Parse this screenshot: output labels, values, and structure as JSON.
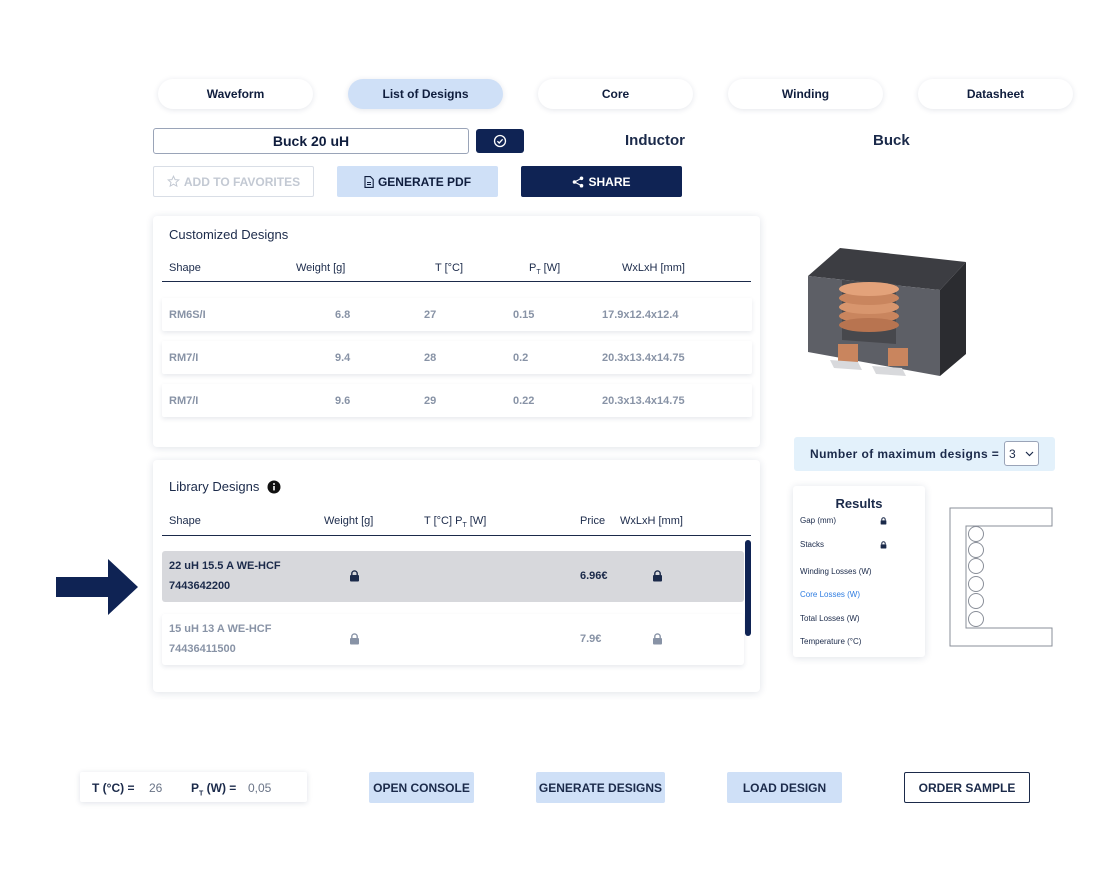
{
  "tabs": [
    {
      "label": "Waveform"
    },
    {
      "label": "List of Designs",
      "active": true
    },
    {
      "label": "Core"
    },
    {
      "label": "Winding"
    },
    {
      "label": "Datasheet"
    }
  ],
  "design": {
    "name": "Buck 20 uH",
    "type": "Inductor",
    "topology": "Buck"
  },
  "actions": {
    "favorites": "ADD TO FAVORITES",
    "pdf": "GENERATE PDF",
    "share": "SHARE"
  },
  "customized": {
    "title": "Customized Designs",
    "columns": [
      "Shape",
      "Weight [g]",
      "T [°C]",
      "P",
      "T",
      " [W]",
      "WxLxH [mm]"
    ],
    "rows": [
      {
        "shape": "RM6S/I",
        "weight": "6.8",
        "temp": "27",
        "power": "0.15",
        "dims": "17.9x12.4x12.4"
      },
      {
        "shape": "RM7/I",
        "weight": "9.4",
        "temp": "28",
        "power": "0.2",
        "dims": "20.3x13.4x14.75"
      },
      {
        "shape": "RM7/I",
        "weight": "9.6",
        "temp": "29",
        "power": "0.22",
        "dims": "20.3x13.4x14.75"
      }
    ]
  },
  "library": {
    "title": "Library Designs",
    "columns": {
      "shape": "Shape",
      "weight": "Weight [g]",
      "temp_power": "T [°C] P",
      "t_sub": "T",
      "w": " [W]",
      "price": "Price",
      "dims": "WxLxH [mm]"
    },
    "rows": [
      {
        "line1": "22 uH 15.5 A WE-HCF",
        "line2": "7443642200",
        "price": "6.96€",
        "selected": true
      },
      {
        "line1": "15 uH 13 A WE-HCF",
        "line2": "74436411500",
        "price": "7.9€",
        "selected": false
      }
    ]
  },
  "max_designs": {
    "label": "Number of maximum designs =",
    "value": "3"
  },
  "results": {
    "title": "Results",
    "items": [
      {
        "label": "Gap (mm)",
        "locked": true
      },
      {
        "label": "Stacks",
        "locked": true
      },
      {
        "label": "Winding Losses (W)",
        "locked": false
      },
      {
        "label": "Core Losses (W)",
        "locked": false,
        "highlight": true
      },
      {
        "label": "Total Losses (W)",
        "locked": false
      },
      {
        "label": "Temperature (°C)",
        "locked": false
      }
    ]
  },
  "bottom": {
    "t_label": "T (°C) =",
    "t_value": "26",
    "p_label_a": "P",
    "p_label_sub": "T",
    "p_label_b": " (W) =",
    "p_value": "0,05",
    "open_console": "OPEN CONSOLE",
    "generate": "GENERATE DESIGNS",
    "load": "LOAD DESIGN",
    "order": "ORDER SAMPLE"
  },
  "colors": {
    "navy": "#0f2354",
    "light_blue": "#cfe0f7",
    "highlight": "#2f7de1"
  }
}
